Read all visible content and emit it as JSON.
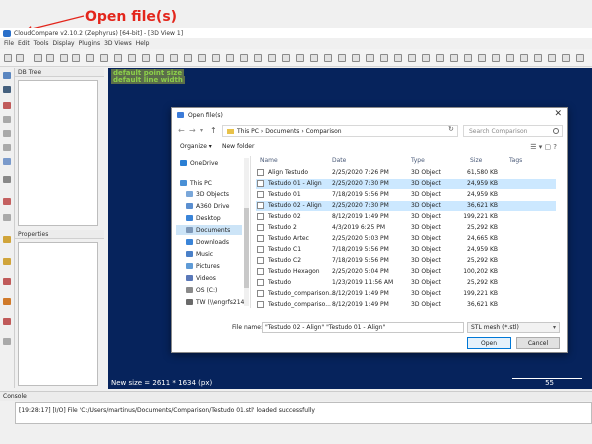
{
  "annotation": {
    "text": "Open file(s)",
    "color": "#e3261c"
  },
  "app": {
    "title": "CloudCompare v2.10.2 (Zephyrus) [64-bit] - [3D View 1]",
    "menu": [
      "File",
      "Edit",
      "Tools",
      "Display",
      "Plugins",
      "3D Views",
      "Help"
    ]
  },
  "panels": {
    "db_tree": "DB Tree",
    "properties": "Properties",
    "console": "Console"
  },
  "viewport": {
    "info_lines": [
      "default point size",
      "default line width"
    ],
    "size_text": "New size = 2611 * 1634 (px)",
    "scale_value": "55",
    "background_color": "#06235c"
  },
  "console": {
    "message": "[19:28:17] [I/O] File 'C:/Users/martinus/Documents/Comparison/Testudo 01.stl' loaded successfully"
  },
  "dialog": {
    "title": "Open file(s)",
    "address": [
      "This PC",
      "Documents",
      "Comparison"
    ],
    "search_placeholder": "Search Comparison",
    "organize": "Organize",
    "new_folder": "New folder",
    "nav_items": [
      {
        "label": "OneDrive",
        "icon": "cloud-icon",
        "color": "#2a7fd4"
      },
      {
        "label": "This PC",
        "icon": "computer-icon",
        "color": "#4a90d6"
      },
      {
        "label": "3D Objects",
        "icon": "cube-icon",
        "color": "#7aa7d9"
      },
      {
        "label": "A360 Drive",
        "icon": "drive-icon",
        "color": "#5b8fd0"
      },
      {
        "label": "Desktop",
        "icon": "desktop-icon",
        "color": "#3a84d8"
      },
      {
        "label": "Documents",
        "icon": "document-icon",
        "color": "#7d98b8"
      },
      {
        "label": "Downloads",
        "icon": "download-icon",
        "color": "#3a84d8"
      },
      {
        "label": "Music",
        "icon": "music-icon",
        "color": "#4a80c8"
      },
      {
        "label": "Pictures",
        "icon": "picture-icon",
        "color": "#5f9bd6"
      },
      {
        "label": "Videos",
        "icon": "video-icon",
        "color": "#5a78b8"
      },
      {
        "label": "OS (C:)",
        "icon": "disk-icon",
        "color": "#8a8a8a"
      },
      {
        "label": "TW (\\\\engrfs214",
        "icon": "network-drive-icon",
        "color": "#6a6a6a"
      }
    ],
    "selected_nav": "Documents",
    "columns": [
      "Name",
      "Date",
      "Type",
      "Size",
      "Tags"
    ],
    "files": [
      {
        "name": "Align Testudo",
        "date": "2/25/2020 7:26 PM",
        "type": "3D Object",
        "size": "61,580 KB",
        "selected": false
      },
      {
        "name": "Testudo 01 - Align",
        "date": "2/25/2020 7:30 PM",
        "type": "3D Object",
        "size": "24,959 KB",
        "selected": true
      },
      {
        "name": "Testudo 01",
        "date": "7/18/2019 5:56 PM",
        "type": "3D Object",
        "size": "24,959 KB",
        "selected": false
      },
      {
        "name": "Testudo 02 - Align",
        "date": "2/25/2020 7:30 PM",
        "type": "3D Object",
        "size": "36,621 KB",
        "selected": true
      },
      {
        "name": "Testudo 02",
        "date": "8/12/2019 1:49 PM",
        "type": "3D Object",
        "size": "199,221 KB",
        "selected": false
      },
      {
        "name": "Testudo 2",
        "date": "4/3/2019 6:25 PM",
        "type": "3D Object",
        "size": "25,292 KB",
        "selected": false
      },
      {
        "name": "Testudo Artec",
        "date": "2/25/2020 5:03 PM",
        "type": "3D Object",
        "size": "24,665 KB",
        "selected": false
      },
      {
        "name": "Testudo C1",
        "date": "7/18/2019 5:56 PM",
        "type": "3D Object",
        "size": "24,959 KB",
        "selected": false
      },
      {
        "name": "Testudo C2",
        "date": "7/18/2019 5:56 PM",
        "type": "3D Object",
        "size": "25,292 KB",
        "selected": false
      },
      {
        "name": "Testudo Hexagon",
        "date": "2/25/2020 5:04 PM",
        "type": "3D Object",
        "size": "100,202 KB",
        "selected": false
      },
      {
        "name": "Testudo",
        "date": "1/23/2019 11:56 AM",
        "type": "3D Object",
        "size": "25,292 KB",
        "selected": false
      },
      {
        "name": "Testudo_comparison...",
        "date": "8/12/2019 1:49 PM",
        "type": "3D Object",
        "size": "199,221 KB",
        "selected": false
      },
      {
        "name": "Testudo_compariso...",
        "date": "8/12/2019 1:49 PM",
        "type": "3D Object",
        "size": "36,621 KB",
        "selected": false
      }
    ],
    "file_name_label": "File name:",
    "file_name_value": "\"Testudo 02 - Align\" \"Testudo 01 - Align\"",
    "file_type": "STL mesh (*.stl)",
    "open_label": "Open",
    "cancel_label": "Cancel"
  }
}
